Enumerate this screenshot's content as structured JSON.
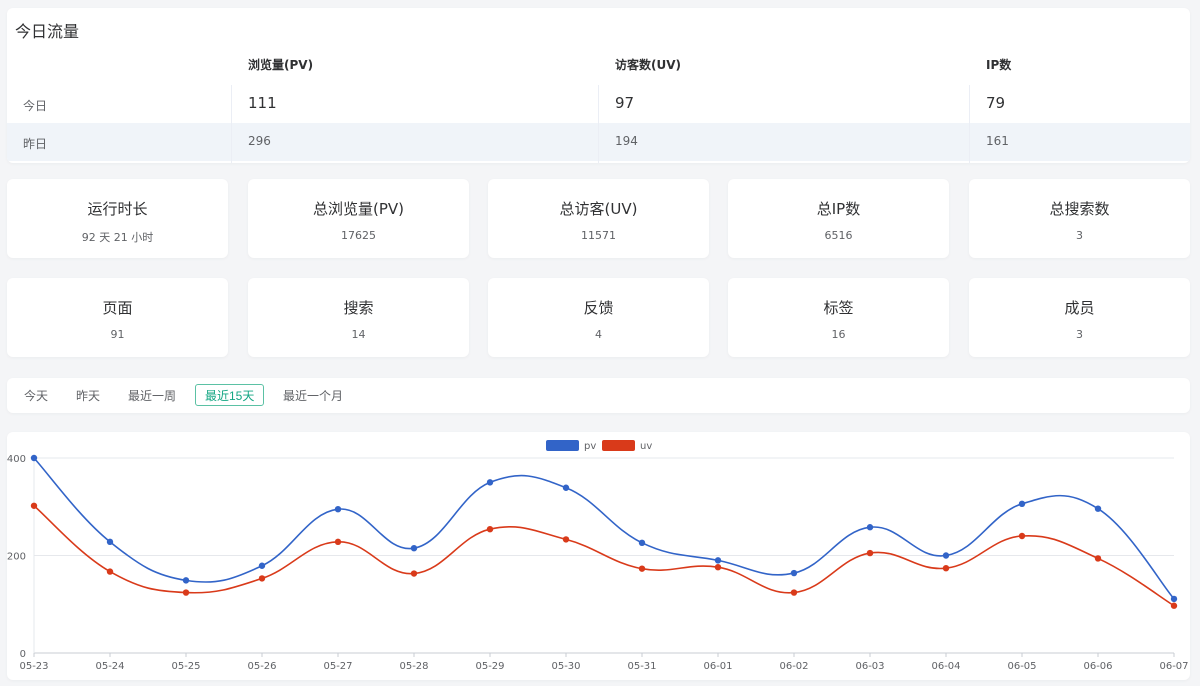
{
  "traffic": {
    "title": "今日流量",
    "headers": [
      "浏览量(PV)",
      "访客数(UV)",
      "IP数"
    ],
    "rows": [
      {
        "label": "今日",
        "pv": "111",
        "uv": "97",
        "ip": "79"
      },
      {
        "label": "昨日",
        "pv": "296",
        "uv": "194",
        "ip": "161"
      }
    ]
  },
  "stats_row1": [
    {
      "title": "运行时长",
      "value": "92 天 21 小时"
    },
    {
      "title": "总浏览量(PV)",
      "value": "17625"
    },
    {
      "title": "总访客(UV)",
      "value": "11571"
    },
    {
      "title": "总IP数",
      "value": "6516"
    },
    {
      "title": "总搜索数",
      "value": "3"
    }
  ],
  "stats_row2": [
    {
      "title": "页面",
      "value": "91"
    },
    {
      "title": "搜索",
      "value": "14"
    },
    {
      "title": "反馈",
      "value": "4"
    },
    {
      "title": "标签",
      "value": "16"
    },
    {
      "title": "成员",
      "value": "3"
    }
  ],
  "range_tabs": {
    "items": [
      "今天",
      "昨天",
      "最近一周",
      "最近15天",
      "最近一个月"
    ],
    "active_index": 3
  },
  "colors": {
    "pv": "#3264c8",
    "uv": "#d93a1a",
    "accent": "#13a683"
  },
  "chart_data": {
    "type": "line",
    "categories": [
      "05-23",
      "05-24",
      "05-25",
      "05-26",
      "05-27",
      "05-28",
      "05-29",
      "05-30",
      "05-31",
      "06-01",
      "06-02",
      "06-03",
      "06-04",
      "06-05",
      "06-06",
      "06-07"
    ],
    "series": [
      {
        "name": "pv",
        "values": [
          400,
          228,
          149,
          179,
          295,
          215,
          350,
          339,
          226,
          190,
          164,
          258,
          200,
          306,
          296,
          111
        ]
      },
      {
        "name": "uv",
        "values": [
          302,
          167,
          124,
          153,
          228,
          163,
          254,
          233,
          173,
          176,
          124,
          205,
          174,
          240,
          194,
          97
        ]
      }
    ],
    "ylim": [
      0,
      400
    ],
    "yticks": [
      "0",
      "200",
      "400"
    ],
    "legend": "top-center",
    "grid": true
  }
}
